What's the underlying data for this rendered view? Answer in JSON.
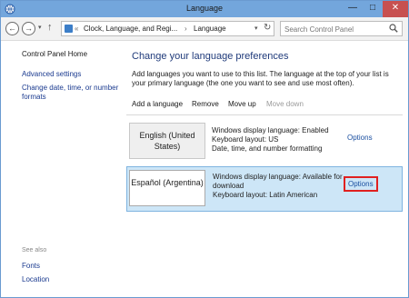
{
  "window": {
    "title": "Language",
    "minimize": "—",
    "maximize": "□",
    "close": "✕"
  },
  "nav": {
    "back": "←",
    "forward": "→",
    "recent": "▾",
    "up": "↑",
    "breadcrumb": [
      "Clock, Language, and Regi...",
      "Language"
    ],
    "breadcrumb_separator": "«",
    "breadcrumb_separator2": "›",
    "address_dropdown": "▾",
    "refresh": "↻",
    "search_placeholder": "Search Control Panel"
  },
  "sidebar": {
    "home": "Control Panel Home",
    "links": [
      "Advanced settings",
      "Change date, time, or number formats"
    ],
    "see_also_label": "See also",
    "see_also": [
      "Fonts",
      "Location"
    ]
  },
  "main": {
    "heading": "Change your language preferences",
    "description": "Add languages you want to use to this list. The language at the top of your list is your primary language (the one you want to see and use most often).",
    "toolbar": {
      "add": "Add a language",
      "remove": "Remove",
      "move_up": "Move up",
      "move_down": "Move down"
    },
    "languages": [
      {
        "name": "English (United States)",
        "details": [
          "Windows display language: Enabled",
          "Keyboard layout: US",
          "Date, time, and number formatting"
        ],
        "options": "Options"
      },
      {
        "name": "Español (Argentina)",
        "details": [
          "Windows display language: Available for download",
          "Keyboard layout: Latin American"
        ],
        "options": "Options"
      }
    ]
  },
  "colors": {
    "titlebar": "#73a6dc",
    "heading": "#1f3a7a",
    "link": "#1a3a8f",
    "selected_row": "#cde6f7",
    "highlight_box": "#e02020"
  }
}
